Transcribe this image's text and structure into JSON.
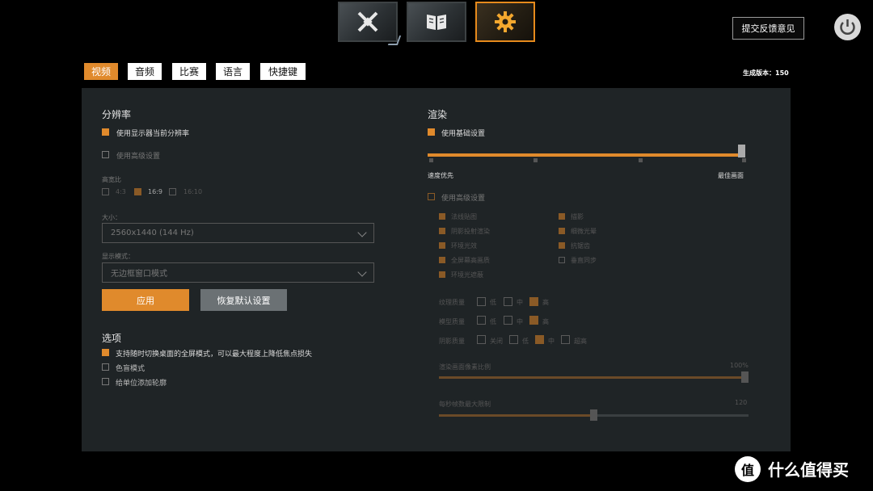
{
  "top_tabs": [
    {
      "icon": "crossed-swords-icon"
    },
    {
      "icon": "book-icon"
    },
    {
      "icon": "gear-icon",
      "active": true
    }
  ],
  "feedback_label": "提交反馈意见",
  "settings_tabs": [
    "视频",
    "音频",
    "比赛",
    "语言",
    "快捷键"
  ],
  "version_label": "生成版本：150",
  "resolution": {
    "title": "分辨率",
    "use_monitor_res": "使用显示器当前分辨率",
    "use_advanced": "使用高级设置",
    "aspect_label": "高宽比",
    "aspect_options": [
      "4:3",
      "16:9",
      "16:10"
    ],
    "aspect_selected": "16:9",
    "size_label": "大小：",
    "size_value": "2560x1440 (144 Hz)",
    "display_mode_label": "显示模式：",
    "display_mode_value": "无边框窗口模式",
    "apply_label": "应用",
    "reset_label": "恢复默认设置"
  },
  "options": {
    "title": "选项",
    "items": [
      {
        "label": "支持随时切换桌面的全屏模式，可以最大程度上降低焦点损失",
        "checked": true
      },
      {
        "label": "色盲模式",
        "checked": false
      },
      {
        "label": "给单位添加轮廓",
        "checked": false
      }
    ]
  },
  "render": {
    "title": "渲染",
    "use_basic": "使用基础设置",
    "quality_level": 1.0,
    "slider_left_label": "速度优先",
    "slider_right_label": "最佳画面",
    "use_advanced": "使用高级设置",
    "advanced_left": [
      "法线贴图",
      "阴影投射渲染",
      "环境光效",
      "全屏幕高画质",
      "环境光遮蔽"
    ],
    "advanced_right": [
      "描影",
      "细微光晕",
      "抗锯齿",
      "垂直同步"
    ],
    "row1_label": "纹理质量",
    "row1_options": [
      "低",
      "中",
      "高"
    ],
    "row2_label": "模型质量",
    "row2_options": [
      "低",
      "中",
      "高"
    ],
    "row3_label": "阴影质量",
    "row3_options": [
      "关闭",
      "低",
      "中",
      "超高"
    ],
    "slider2_label": "渲染画面像素比例",
    "slider2_value": "100%",
    "slider2_level": 1.0,
    "slider3_label": "每秒帧数最大限制",
    "slider3_value": "120",
    "slider3_level": 0.5
  },
  "watermark": {
    "logo": "值",
    "text": "什么值得买"
  }
}
